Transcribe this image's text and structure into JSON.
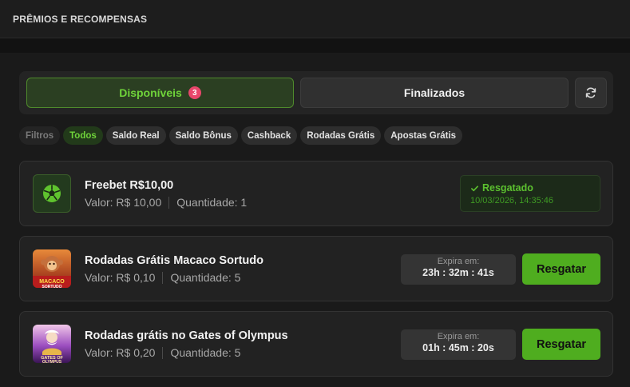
{
  "header": {
    "title": "PRÊMIOS E RECOMPENSAS"
  },
  "tabs": {
    "available": {
      "label": "Disponíveis",
      "badge": "3"
    },
    "finished": {
      "label": "Finalizados"
    },
    "refresh_icon": "refresh-icon"
  },
  "filters": {
    "label": "Filtros",
    "options": [
      "Todos",
      "Saldo Real",
      "Saldo Bônus",
      "Cashback",
      "Rodadas Grátis",
      "Apostas Grátis"
    ],
    "active": "Todos"
  },
  "rewards": [
    {
      "title": "Freebet R$10,00",
      "value": "Valor: R$ 10,00",
      "quantity": "Quantidade: 1",
      "icon": "soccer-ball-icon",
      "status": {
        "label": "Resgatado",
        "date": "10/03/2026, 14:35:46"
      }
    },
    {
      "title": "Rodadas Grátis Macaco Sortudo",
      "value": "Valor: R$ 0,10",
      "quantity": "Quantidade: 5",
      "icon": "macaco-sortudo-game-thumbnail",
      "thumb_text": "MACACO SORTUDO",
      "expire_label": "Expira em:",
      "expire_time": "23h : 32m : 41s",
      "button": "Resgatar"
    },
    {
      "title": "Rodadas grátis no Gates of Olympus",
      "value": "Valor: R$ 0,20",
      "quantity": "Quantidade: 5",
      "icon": "gates-of-olympus-game-thumbnail",
      "thumb_text": "GATES OF OLYMPUS",
      "expire_label": "Expira em:",
      "expire_time": "01h : 45m : 20s",
      "button": "Resgatar"
    }
  ],
  "colors": {
    "accent_green": "#4fad1f",
    "active_text_green": "#6fd33a",
    "badge_pink": "#e8476b",
    "background": "#121212"
  }
}
